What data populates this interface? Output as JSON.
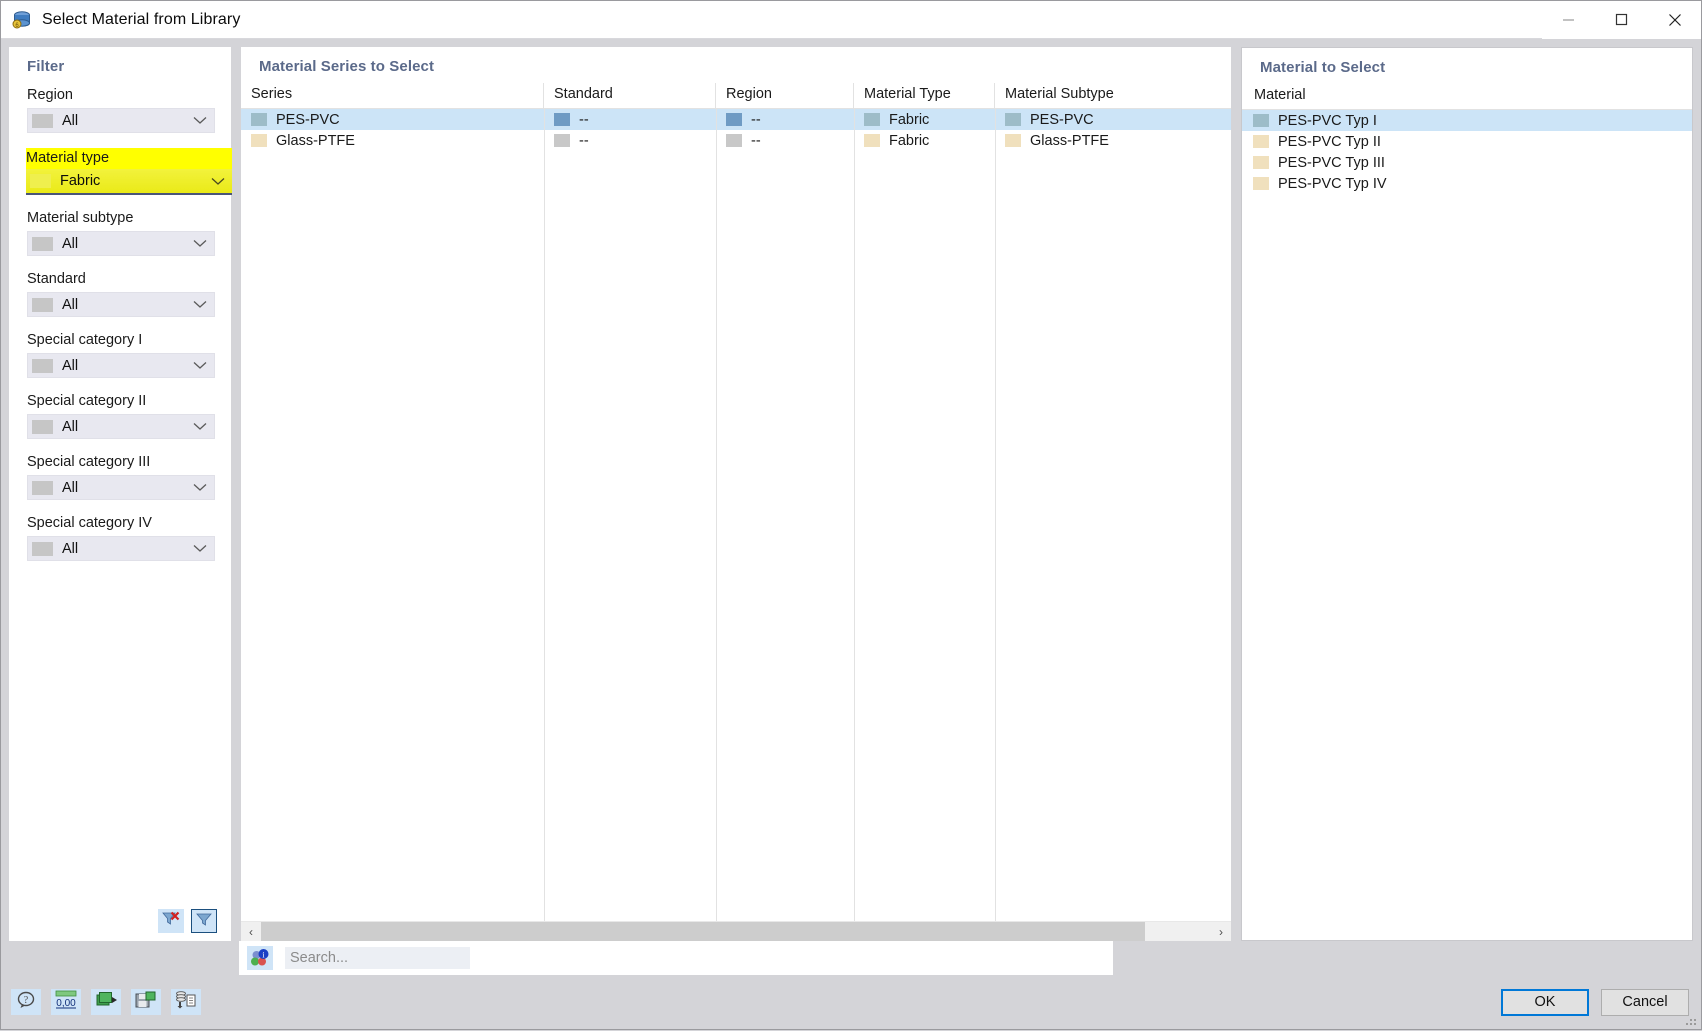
{
  "window": {
    "title": "Select Material from Library",
    "icon": "database-material-icon",
    "minimize_label": "Minimize",
    "maximize_label": "Maximize",
    "close_label": "Close"
  },
  "filter": {
    "title": "Filter",
    "fields": [
      {
        "label": "Region",
        "value": "All",
        "highlight": false
      },
      {
        "label": "Material type",
        "value": "Fabric",
        "highlight": true
      },
      {
        "label": "Material subtype",
        "value": "All",
        "highlight": false
      },
      {
        "label": "Standard",
        "value": "All",
        "highlight": false
      },
      {
        "label": "Special category I",
        "value": "All",
        "highlight": false
      },
      {
        "label": "Special category II",
        "value": "All",
        "highlight": false
      },
      {
        "label": "Special category III",
        "value": "All",
        "highlight": false
      },
      {
        "label": "Special category IV",
        "value": "All",
        "highlight": false
      }
    ],
    "actions": [
      {
        "name": "clear-filter-button",
        "icon": "funnel-clear-icon",
        "active": false
      },
      {
        "name": "apply-filter-button",
        "icon": "funnel-icon",
        "active": true
      }
    ]
  },
  "series_panel": {
    "title": "Material Series to Select",
    "columns": [
      "Series",
      "Standard",
      "Region",
      "Material Type",
      "Material Subtype"
    ],
    "rows": [
      {
        "selected": true,
        "color": "#9dbcc8",
        "cells": [
          "PES-PVC",
          "--",
          "--",
          "Fabric",
          "PES-PVC"
        ],
        "swatches": [
          "#9dbcc8",
          "#6f9bc4",
          "#6f9bc4",
          "#9dbcc8",
          "#9dbcc8"
        ]
      },
      {
        "selected": false,
        "color": "#f0e0bd",
        "cells": [
          "Glass-PTFE",
          "--",
          "--",
          "Fabric",
          "Glass-PTFE"
        ],
        "swatches": [
          "#f0e0bd",
          "#c8c8c8",
          "#c8c8c8",
          "#f0e0bd",
          "#f0e0bd"
        ]
      }
    ],
    "scrollbar": {
      "left_arrow": "‹",
      "right_arrow": "›"
    }
  },
  "material_panel": {
    "title": "Material to Select",
    "column": "Material",
    "items": [
      {
        "label": "PES-PVC Typ I",
        "color": "#9dbcc8",
        "selected": true
      },
      {
        "label": "PES-PVC Typ II",
        "color": "#f0e0bd",
        "selected": false
      },
      {
        "label": "PES-PVC Typ III",
        "color": "#f0e0bd",
        "selected": false
      },
      {
        "label": "PES-PVC Typ IV",
        "color": "#f0e0bd",
        "selected": false
      }
    ]
  },
  "search": {
    "placeholder": "Search...",
    "value": "",
    "icon": "info-material-icon"
  },
  "footer": {
    "tools": [
      {
        "name": "help-button",
        "icon": "question-bubble-icon"
      },
      {
        "name": "decimals-button",
        "icon": "number-format-icon",
        "label": "0,00"
      },
      {
        "name": "export-button",
        "icon": "export-database-icon"
      },
      {
        "name": "save-button",
        "icon": "save-database-icon"
      },
      {
        "name": "report-button",
        "icon": "database-to-document-icon"
      }
    ],
    "ok_label": "OK",
    "cancel_label": "Cancel"
  },
  "colors": {
    "accent": "#0078d7",
    "panel_title": "#5b6a8a",
    "selection": "#cce4f7",
    "highlight": "#ffff00"
  }
}
